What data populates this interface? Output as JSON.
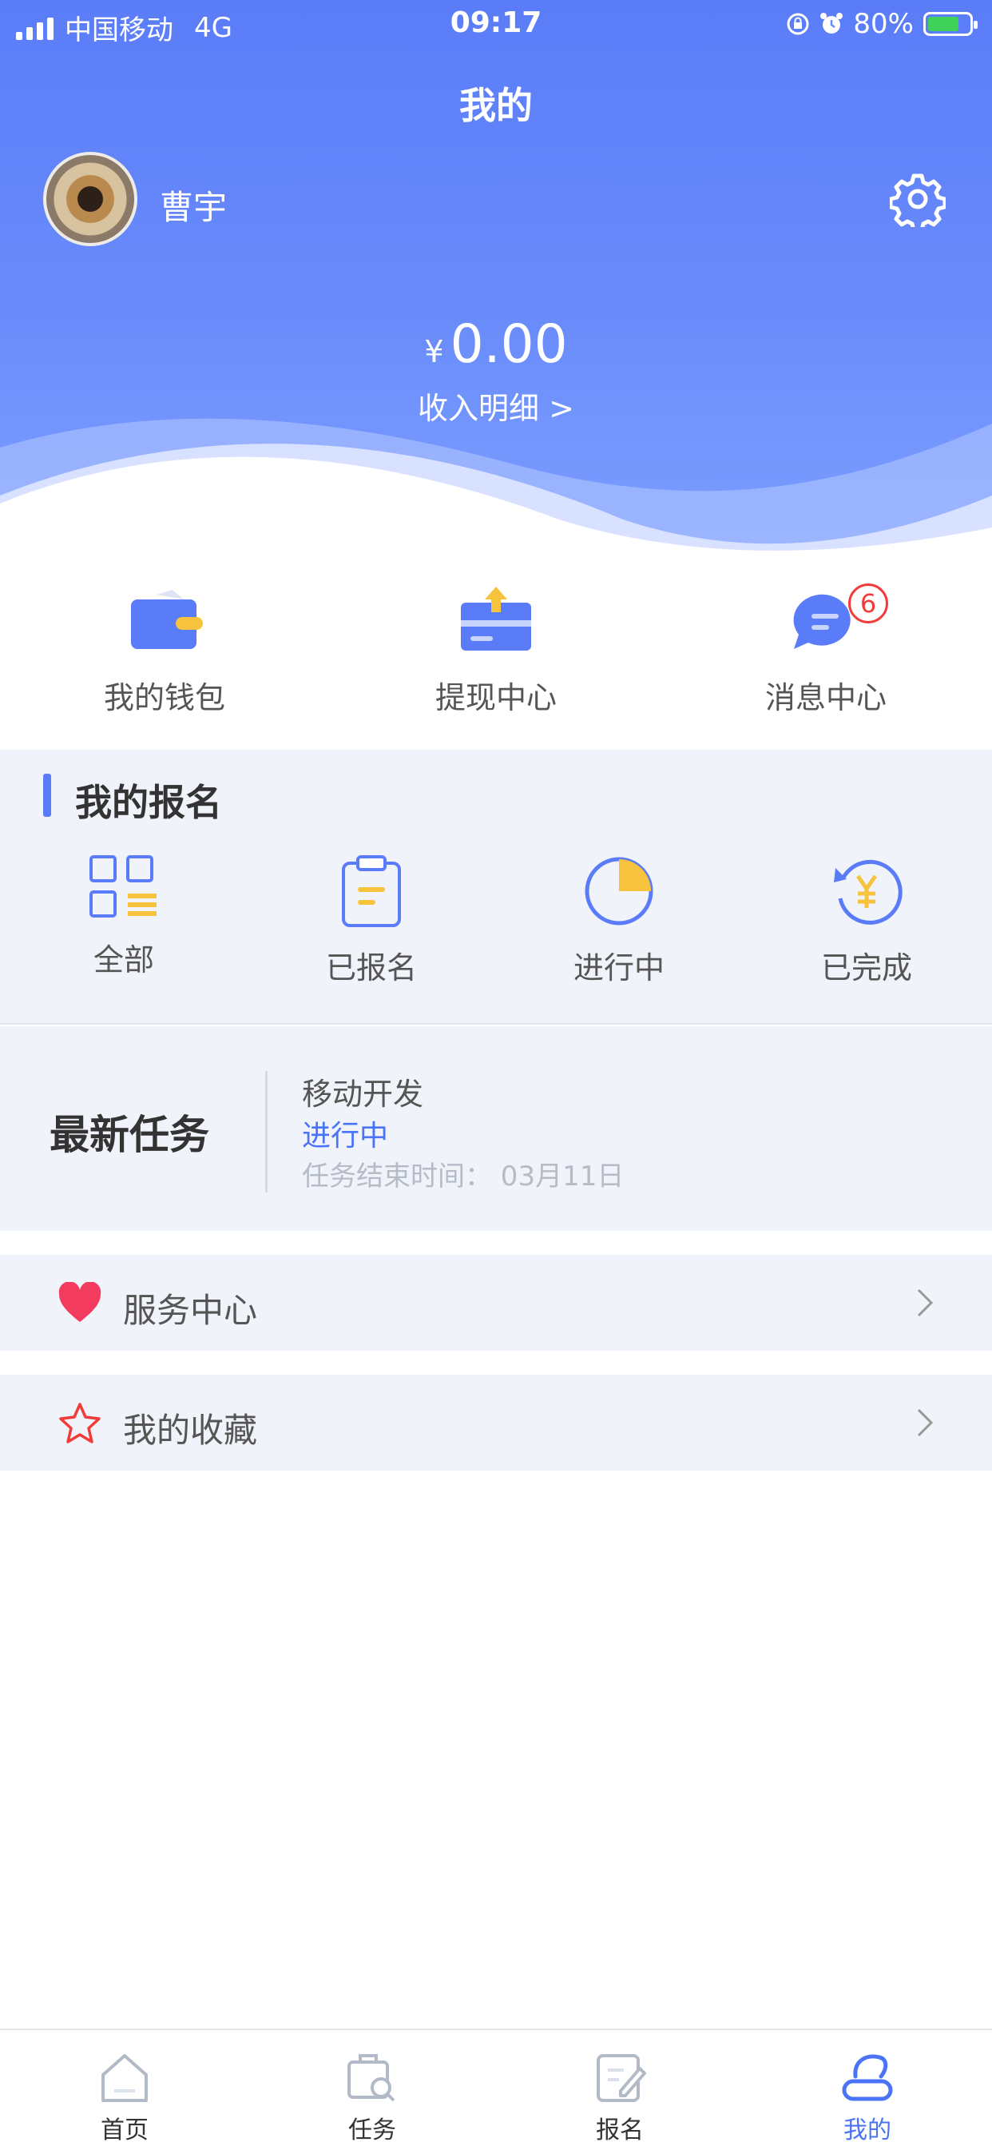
{
  "status_bar": {
    "carrier": "中国移动",
    "network": "4G",
    "time": "09:17",
    "battery": "80%"
  },
  "page": {
    "title": "我的"
  },
  "profile": {
    "username": "曹宇"
  },
  "balance": {
    "currency": "¥",
    "amount": "0.00",
    "income_link": "收入明细 >"
  },
  "quick_actions": [
    {
      "label": "我的钱包",
      "icon": "wallet-icon"
    },
    {
      "label": "提现中心",
      "icon": "withdraw-icon"
    },
    {
      "label": "消息中心",
      "icon": "message-icon",
      "badge": "6"
    }
  ],
  "registration": {
    "title": "我的报名",
    "items": [
      {
        "label": "全部",
        "icon": "grid-list-icon"
      },
      {
        "label": "已报名",
        "icon": "clipboard-icon"
      },
      {
        "label": "进行中",
        "icon": "pie-progress-icon"
      },
      {
        "label": "已完成",
        "icon": "yen-refresh-icon"
      }
    ]
  },
  "latest_task": {
    "title": "最新任务",
    "name": "移动开发",
    "status": "进行中",
    "end_time": "任务结束时间：  03月11日"
  },
  "menu": [
    {
      "label": "服务中心",
      "icon": "heart-icon"
    },
    {
      "label": "我的收藏",
      "icon": "star-icon"
    }
  ],
  "tabbar": [
    {
      "label": "首页",
      "icon": "home-icon"
    },
    {
      "label": "任务",
      "icon": "task-search-icon"
    },
    {
      "label": "报名",
      "icon": "edit-doc-icon"
    },
    {
      "label": "我的",
      "icon": "user-icon",
      "active": true
    }
  ],
  "colors": {
    "primary": "#5a7cf8",
    "accent_yellow": "#f7c33c",
    "badge_red": "#f23b3b",
    "link_blue": "#4a74f5"
  }
}
